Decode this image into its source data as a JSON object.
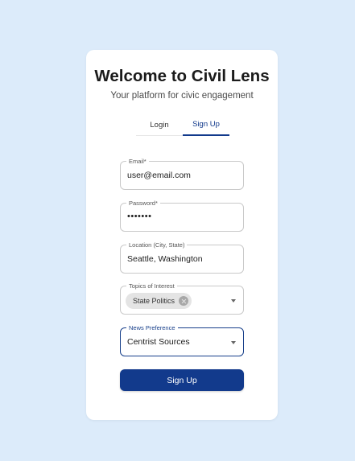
{
  "header": {
    "title": "Welcome to Civil Lens",
    "subtitle": "Your platform for civic engagement"
  },
  "tabs": [
    {
      "label": "Login",
      "active": false
    },
    {
      "label": "Sign Up",
      "active": true
    }
  ],
  "form": {
    "email": {
      "label": "Email",
      "required_mark": "*",
      "value": "user@email.com"
    },
    "password": {
      "label": "Password",
      "required_mark": "*",
      "value": "•••••••"
    },
    "location": {
      "label": "Location (City, State)",
      "value": "Seattle, Washington"
    },
    "topics": {
      "label": "Topics of Interest",
      "chips": [
        "State Politics"
      ]
    },
    "news": {
      "label": "News Preference",
      "value": "Centrist Sources"
    },
    "submit_label": "Sign Up"
  },
  "colors": {
    "background": "#dcebfa",
    "primary": "#123a8c",
    "card": "#ffffff"
  },
  "icons": [
    "chevron-down-icon",
    "chip-remove-icon"
  ]
}
